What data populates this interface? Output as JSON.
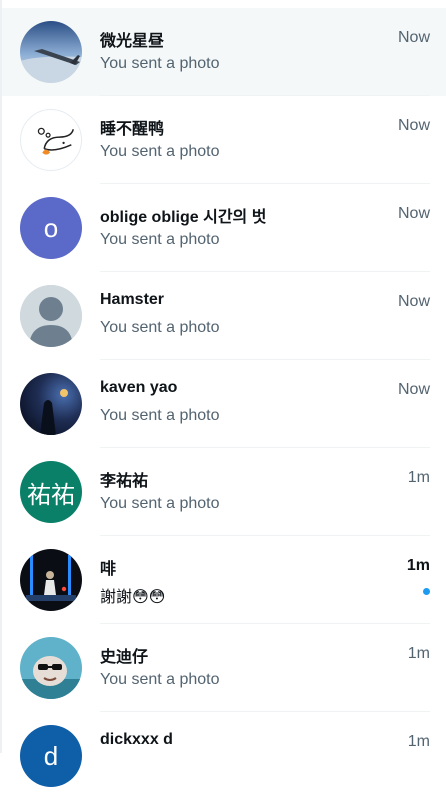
{
  "conversations": [
    {
      "name": "微光星昼",
      "time": "Now",
      "preview": "You sent a photo",
      "avatar_icon": "airplane-wing-avatar-icon"
    },
    {
      "name": "睡不醒鸭",
      "time": "Now",
      "preview": "You sent a photo",
      "avatar_icon": "sleepy-duck-avatar-icon"
    },
    {
      "name": "oblige oblige 시간의 벗",
      "time": "Now",
      "preview": "You sent a photo",
      "avatar_letter": "o"
    },
    {
      "name": "Hamster",
      "time": "Now",
      "preview": "You sent a photo",
      "avatar_icon": "default-person-avatar-icon"
    },
    {
      "name": "kaven yao",
      "time": "Now",
      "preview": "You sent a photo",
      "avatar_icon": "night-scene-avatar-icon"
    },
    {
      "name": "李祐祐",
      "time": "1m",
      "preview": "You sent a photo",
      "avatar_letter": "祐祐"
    },
    {
      "name": "啡",
      "time": "1m",
      "preview": "謝謝😳😳",
      "unread": true,
      "avatar_icon": "neon-stage-avatar-icon"
    },
    {
      "name": "史迪仔",
      "time": "1m",
      "preview": "You sent a photo",
      "avatar_icon": "cartoon-sunglasses-avatar-icon"
    },
    {
      "name": "dickxxx d",
      "time": "1m",
      "preview": "",
      "avatar_letter": "d"
    }
  ],
  "colors": {
    "unread_dot": "#1d9bf0",
    "secondary_text": "#536471",
    "primary_text": "#0f1419"
  }
}
